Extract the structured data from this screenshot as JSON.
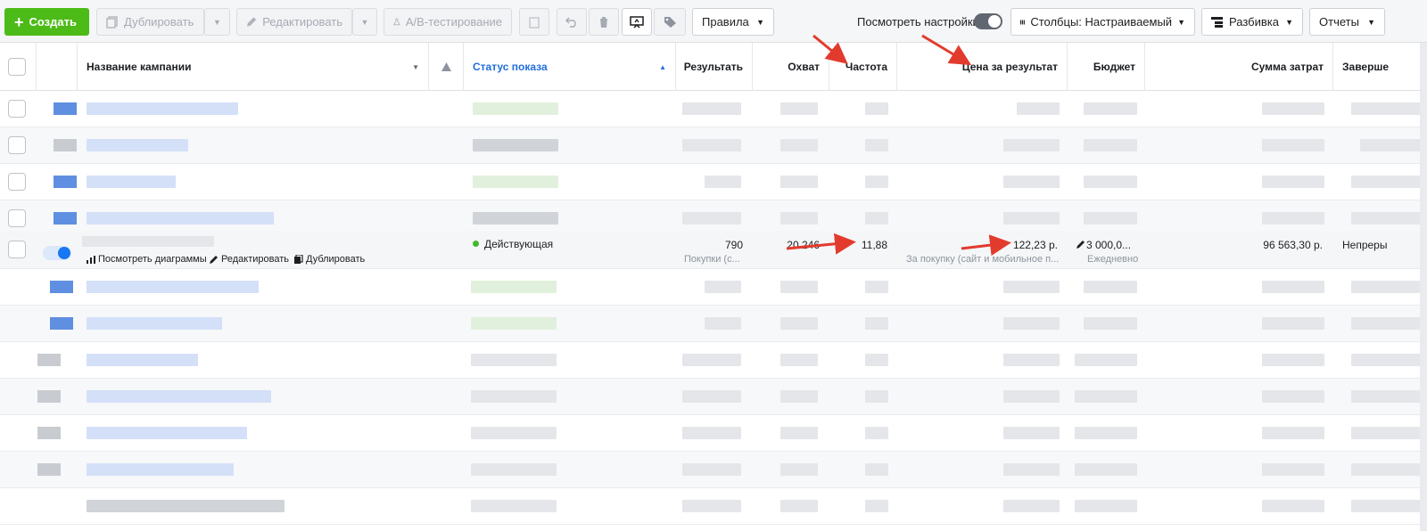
{
  "toolbar": {
    "create": "Создать",
    "duplicate": "Дублировать",
    "edit": "Редактировать",
    "ab_test": "A/B-тестирование",
    "rules": "Правила",
    "view_settings": "Посмотреть настройки",
    "columns": "Столбцы: Настраиваемый",
    "breakdown": "Разбивка",
    "reports": "Отчеты"
  },
  "columns": {
    "campaign_name": "Название кампании",
    "delivery_status": "Статус показа",
    "results": "Результать",
    "reach": "Охват",
    "frequency": "Частота",
    "cost_per_result": "Цена за результат",
    "budget": "Бюджет",
    "amount_spent": "Сумма затрат",
    "ends": "Заверше"
  },
  "focus_row": {
    "actions": {
      "view_charts": "Посмотреть диаграммы",
      "edit": "Редактировать",
      "duplicate": "Дублировать"
    },
    "status": "Действующая",
    "results": "790",
    "results_sub": "Покупки (с...",
    "reach": "20 246",
    "frequency": "11,88",
    "cost_per_result": "122,23 р.",
    "cost_per_result_sub": "За покупку (сайт и мобильное п...",
    "budget": "3 000,0...",
    "budget_sub": "Ежедневно",
    "amount_spent": "96 563,30 р.",
    "ends": "Непреры"
  },
  "colors": {
    "accent": "#216fdb",
    "create_green": "#4cbb17",
    "active_dot": "#42b72a",
    "annotation_arrow": "#e23b2e"
  }
}
